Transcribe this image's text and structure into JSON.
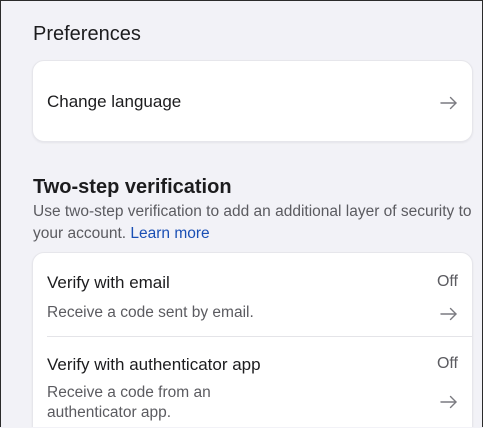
{
  "preferences": {
    "title": "Preferences",
    "change_language_label": "Change language",
    "arrow_icon": "arrow-right-icon"
  },
  "two_step": {
    "title": "Two-step verification",
    "description": "Use two-step verification to add an additional layer of security to your account.",
    "learn_more": "Learn more",
    "options": [
      {
        "title": "Verify with email",
        "status": "Off",
        "description": "Receive a code sent by email."
      },
      {
        "title": "Verify with authenticator app",
        "status": "Off",
        "description": "Receive a code from an authenticator app."
      }
    ]
  },
  "colors": {
    "background": "#f2f2f7",
    "card": "#ffffff",
    "link": "#1a4fb4",
    "secondary_text": "#5b5b60"
  }
}
